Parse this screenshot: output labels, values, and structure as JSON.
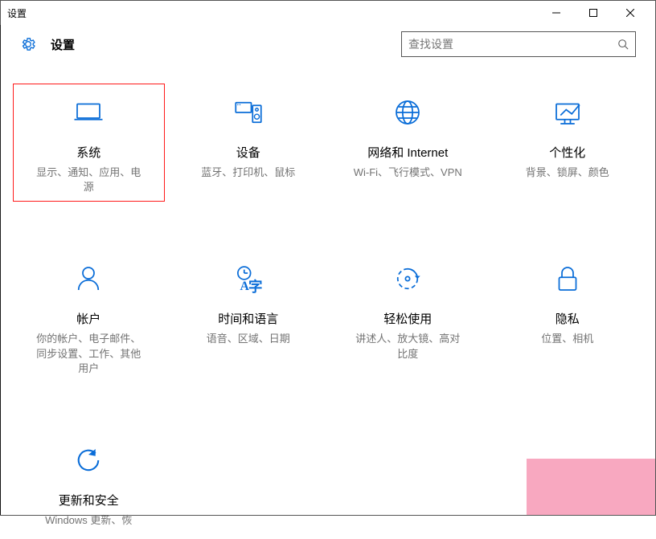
{
  "window": {
    "title": "设置"
  },
  "header": {
    "title": "设置",
    "search_placeholder": "查找设置"
  },
  "tiles": [
    {
      "key": "system",
      "title": "系统",
      "desc": "显示、通知、应用、电\n源",
      "highlight": true
    },
    {
      "key": "devices",
      "title": "设备",
      "desc": "蓝牙、打印机、鼠标",
      "highlight": false
    },
    {
      "key": "network",
      "title": "网络和 Internet",
      "desc": "Wi-Fi、飞行模式、VPN",
      "highlight": false
    },
    {
      "key": "personalize",
      "title": "个性化",
      "desc": "背景、锁屏、颜色",
      "highlight": false
    },
    {
      "key": "accounts",
      "title": "帐户",
      "desc": "你的帐户、电子邮件、\n同步设置、工作、其他\n用户",
      "highlight": false
    },
    {
      "key": "time",
      "title": "时间和语言",
      "desc": "语音、区域、日期",
      "highlight": false
    },
    {
      "key": "ease",
      "title": "轻松使用",
      "desc": "讲述人、放大镜、高对\n比度",
      "highlight": false
    },
    {
      "key": "privacy",
      "title": "隐私",
      "desc": "位置、相机",
      "highlight": false
    },
    {
      "key": "update",
      "title": "更新和安全",
      "desc": "Windows 更新、恢",
      "highlight": false
    }
  ],
  "accent": "#0a6dd8"
}
